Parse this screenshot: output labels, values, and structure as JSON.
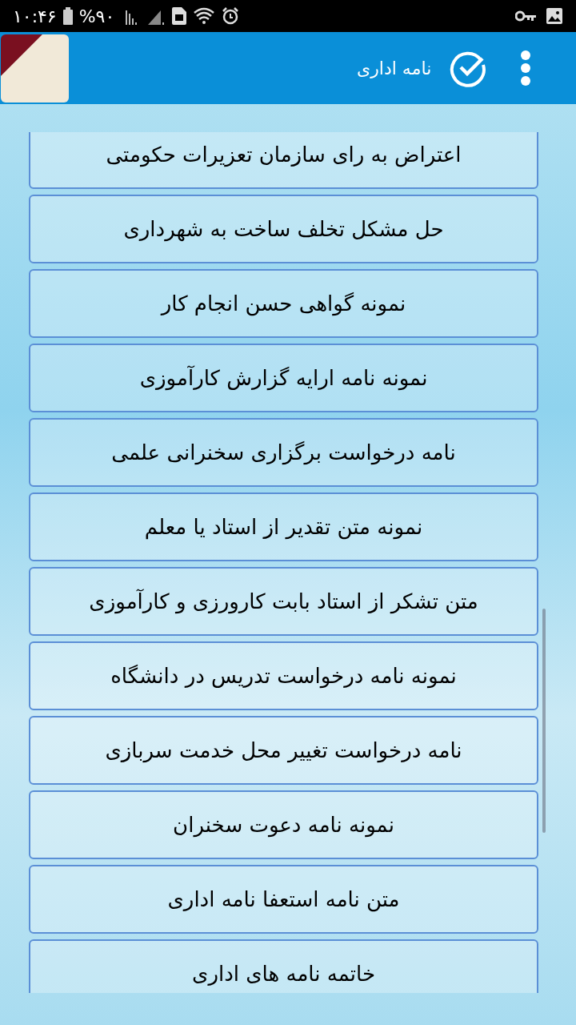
{
  "status_bar": {
    "time": "۱۰:۴۶",
    "battery": "%۹۰"
  },
  "app_bar": {
    "title": "نامه اداری"
  },
  "items": [
    {
      "label": "اعتراض به رای سازمان تعزیرات حکومتی"
    },
    {
      "label": "حل مشکل تخلف ساخت به شهرداری"
    },
    {
      "label": "نمونه گواهی حسن انجام کار"
    },
    {
      "label": "نمونه نامه ارایه گزارش کارآموزی"
    },
    {
      "label": "نامه درخواست برگزاری سخنرانی علمی"
    },
    {
      "label": "نمونه متن تقدیر از استاد یا معلم"
    },
    {
      "label": "متن تشکر از استاد بابت کارورزی و کارآموزی"
    },
    {
      "label": "نمونه نامه درخواست تدریس در دانشگاه"
    },
    {
      "label": "نامه درخواست تغییر محل خدمت سربازی"
    },
    {
      "label": "نمونه نامه دعوت سخنران"
    },
    {
      "label": "متن نامه استعفا نامه اداری"
    },
    {
      "label": "خاتمه نامه های اداری"
    }
  ]
}
